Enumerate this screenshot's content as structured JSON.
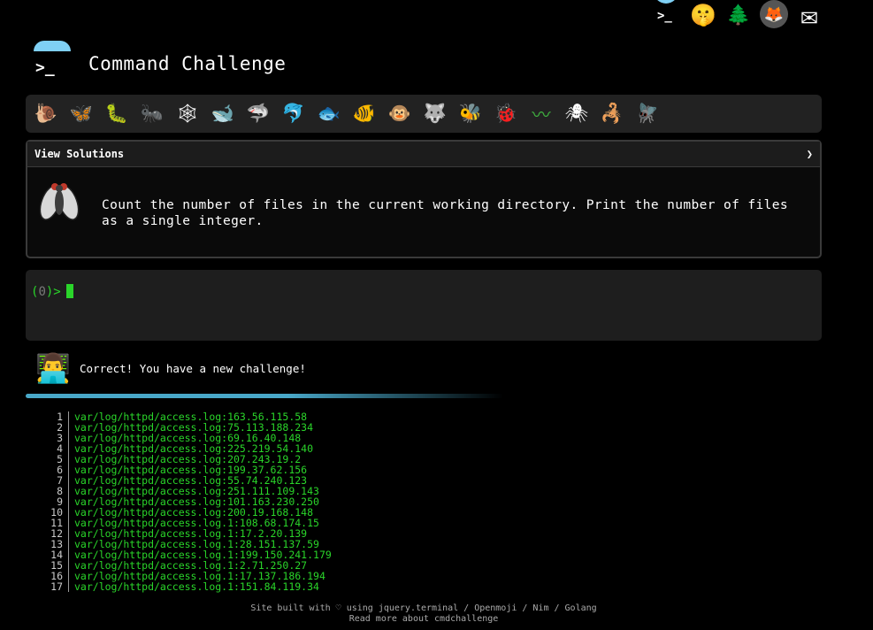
{
  "header": {
    "title": "Command Challenge"
  },
  "logo_symbol": ">_",
  "top_icons": [
    {
      "name": "terminal-icon",
      "glyph": ">_"
    },
    {
      "name": "shushing-face-icon",
      "glyph": "🤫"
    },
    {
      "name": "tree-icon",
      "glyph": "🌲"
    },
    {
      "name": "gitlab-icon",
      "glyph": "🦊"
    },
    {
      "name": "mail-icon",
      "glyph": "✉"
    }
  ],
  "challenges": [
    {
      "name": "snail-icon",
      "glyph": "🐌"
    },
    {
      "name": "butterfly-icon",
      "glyph": "🦋"
    },
    {
      "name": "caterpillar-icon",
      "glyph": "🐛"
    },
    {
      "name": "ant-icon",
      "glyph": "🐜"
    },
    {
      "name": "spiderweb-icon",
      "glyph": "🕸"
    },
    {
      "name": "whale-icon",
      "glyph": "🐋"
    },
    {
      "name": "shark-icon",
      "glyph": "🦈"
    },
    {
      "name": "dolphin-icon",
      "glyph": "🐬"
    },
    {
      "name": "fish-icon",
      "glyph": "🐟"
    },
    {
      "name": "tropical-fish-icon",
      "glyph": "🐠"
    },
    {
      "name": "monkey-face-icon",
      "glyph": "🐵"
    },
    {
      "name": "wolf-icon",
      "glyph": "🐺"
    },
    {
      "name": "bee-icon",
      "glyph": "🐝"
    },
    {
      "name": "ladybug-icon",
      "glyph": "🐞"
    },
    {
      "name": "worm-icon",
      "glyph": "〰"
    },
    {
      "name": "spider-icon",
      "glyph": "🕷"
    },
    {
      "name": "scorpion-icon",
      "glyph": "🦂"
    },
    {
      "name": "fly-icon",
      "glyph": "🪰"
    }
  ],
  "panel": {
    "header_label": "View Solutions",
    "chevron": "❯",
    "description": "Count the number of files in the current working directory. Print the number of files as a single integer."
  },
  "terminal": {
    "prompt_open": "(",
    "prompt_num": "0",
    "prompt_close": ")>"
  },
  "feedback": {
    "avatar_glyph": "👨‍💻",
    "message": "Correct! You have a new challenge!"
  },
  "output": [
    {
      "n": "1",
      "v": "var/log/httpd/access.log:163.56.115.58"
    },
    {
      "n": "2",
      "v": "var/log/httpd/access.log:75.113.188.234"
    },
    {
      "n": "3",
      "v": "var/log/httpd/access.log:69.16.40.148"
    },
    {
      "n": "4",
      "v": "var/log/httpd/access.log:225.219.54.140"
    },
    {
      "n": "5",
      "v": "var/log/httpd/access.log:207.243.19.2"
    },
    {
      "n": "6",
      "v": "var/log/httpd/access.log:199.37.62.156"
    },
    {
      "n": "7",
      "v": "var/log/httpd/access.log:55.74.240.123"
    },
    {
      "n": "8",
      "v": "var/log/httpd/access.log:251.111.109.143"
    },
    {
      "n": "9",
      "v": "var/log/httpd/access.log:101.163.230.250"
    },
    {
      "n": "10",
      "v": "var/log/httpd/access.log:200.19.168.148"
    },
    {
      "n": "11",
      "v": "var/log/httpd/access.log.1:108.68.174.15"
    },
    {
      "n": "12",
      "v": "var/log/httpd/access.log.1:17.2.20.139"
    },
    {
      "n": "13",
      "v": "var/log/httpd/access.log.1:28.151.137.59"
    },
    {
      "n": "14",
      "v": "var/log/httpd/access.log.1:199.150.241.179"
    },
    {
      "n": "15",
      "v": "var/log/httpd/access.log.1:2.71.250.27"
    },
    {
      "n": "16",
      "v": "var/log/httpd/access.log.1:17.137.186.194"
    },
    {
      "n": "17",
      "v": "var/log/httpd/access.log.1:151.84.119.34"
    }
  ],
  "footer": {
    "line1": "Site built with ♡ using jquery.terminal / Openmoji / Nim / Golang",
    "line2": "Read more about cmdchallenge"
  },
  "colors": {
    "accent": "#7fd0f5",
    "terminal_green": "#2ad52a",
    "divider": "#49a8c9"
  }
}
